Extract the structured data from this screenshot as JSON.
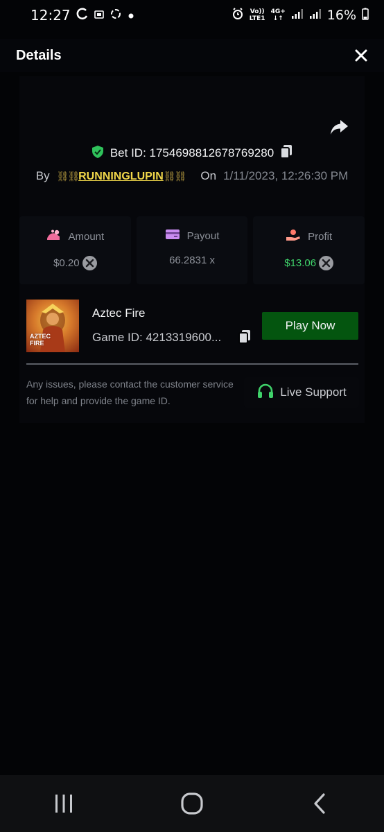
{
  "status_bar": {
    "time": "12:27",
    "network_top": "Vo))",
    "network_bottom": "LTE1",
    "data_type": "4G+",
    "battery": "16%"
  },
  "header": {
    "title": "Details"
  },
  "bet": {
    "label": "Bet ID: 1754698812678769280",
    "by_label": "By",
    "username": "RUNNINGLUPIN",
    "on_label": "On",
    "date": "1/11/2023, 12:26:30 PM"
  },
  "stats": {
    "amount": {
      "label": "Amount",
      "value": "$0.20"
    },
    "payout": {
      "label": "Payout",
      "value": "66.2831 x"
    },
    "profit": {
      "label": "Profit",
      "value": "$13.06"
    }
  },
  "game": {
    "title": "Aztec Fire",
    "id_text": "Game ID: 4213319600...",
    "thumb_line1": "AZTEC",
    "thumb_line2": "FIRE",
    "play_label": "Play Now"
  },
  "support": {
    "text": "Any issues, please contact the customer service for help and provide the game ID.",
    "button_label": "Live Support"
  },
  "colors": {
    "accent_green": "#04550f",
    "profit_green": "#3fd16a",
    "username_yellow": "#f2d84a",
    "shield_green": "#2fc25b",
    "headset_green": "#3fd16a"
  },
  "icons": [
    "clock-icon",
    "refresh-icon",
    "share-icon",
    "shield-check-icon",
    "copy-icon",
    "coin-icon",
    "card-icon",
    "hand-coin-icon",
    "headset-icon",
    "close-icon",
    "recent-apps-icon",
    "home-icon",
    "back-icon"
  ]
}
